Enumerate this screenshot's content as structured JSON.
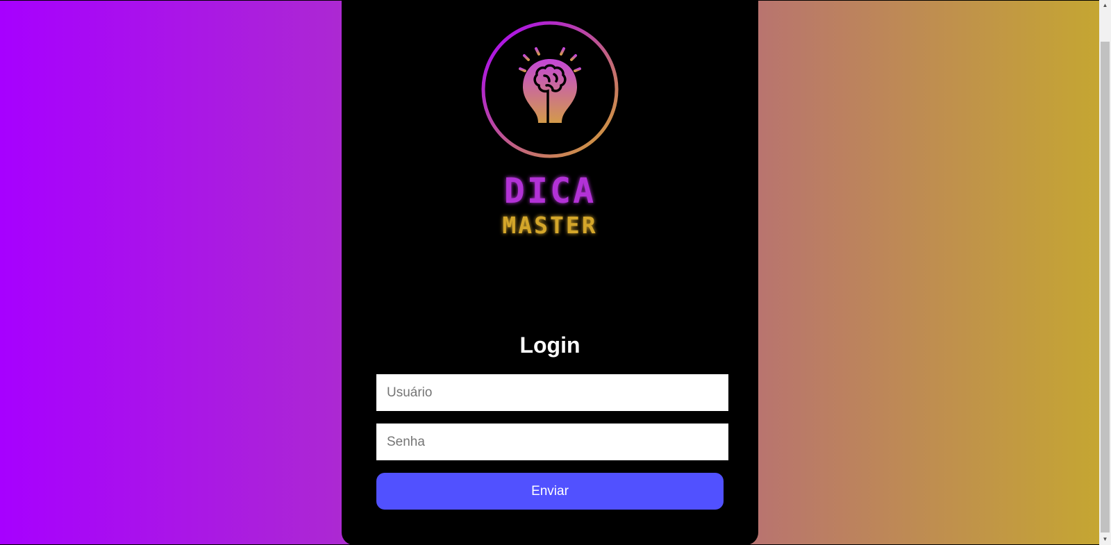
{
  "brand": {
    "line1": "DICA",
    "line2": "MASTER",
    "colors": {
      "purple": "#a700ff",
      "gold": "#d4a62a",
      "gradient_mid": "#c77a6a"
    }
  },
  "login": {
    "title": "Login",
    "username_placeholder": "Usuário",
    "password_placeholder": "Senha",
    "submit_label": "Enviar",
    "submit_color": "#5151ff"
  },
  "icons": {
    "logo": "lightbulb-brain-icon",
    "scroll_up": "chevron-up-icon",
    "scroll_down": "chevron-down-icon"
  }
}
